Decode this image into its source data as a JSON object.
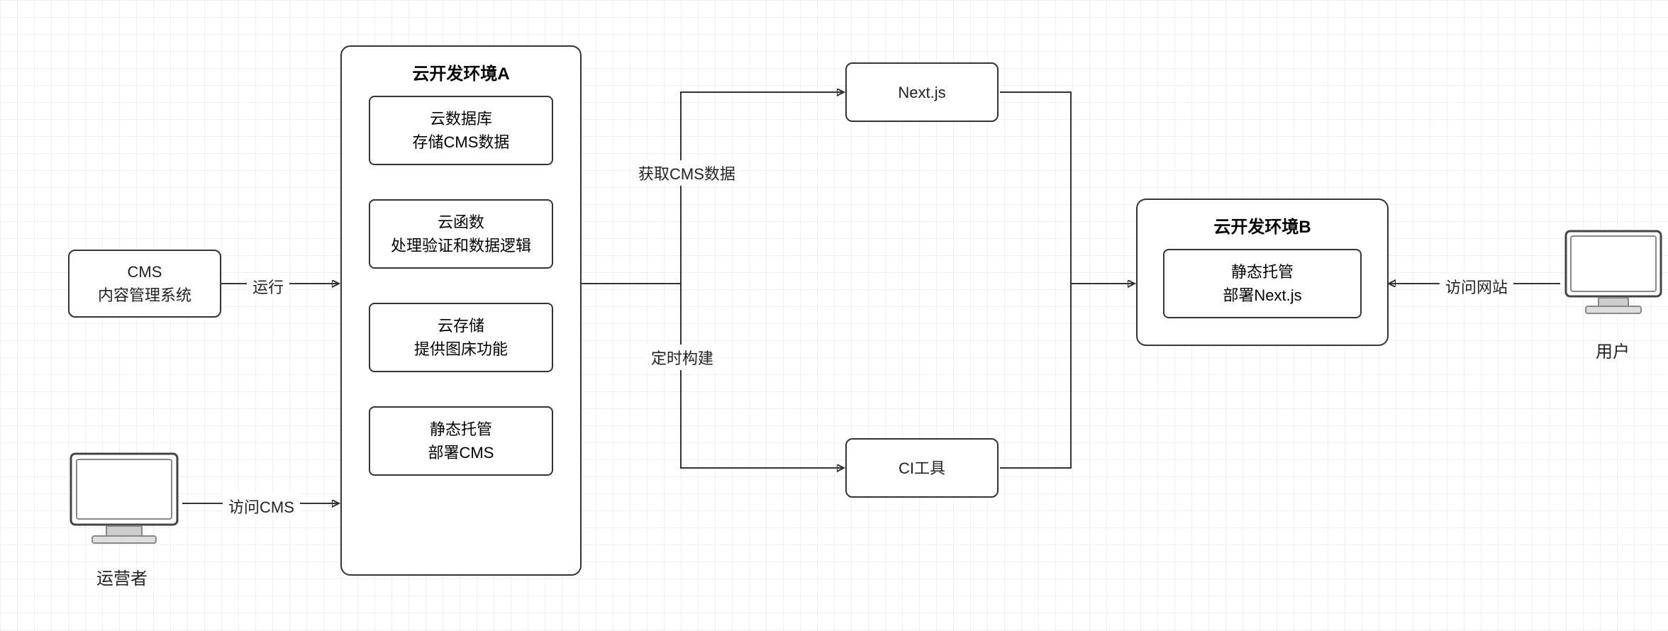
{
  "nodes": {
    "cms": {
      "line1": "CMS",
      "line2": "内容管理系统"
    },
    "envA": {
      "title": "云开发环境A",
      "db": {
        "line1": "云数据库",
        "line2": "存储CMS数据"
      },
      "fn": {
        "line1": "云函数",
        "line2": "处理验证和数据逻辑"
      },
      "stor": {
        "line1": "云存储",
        "line2": "提供图床功能"
      },
      "host": {
        "line1": "静态托管",
        "line2": "部署CMS"
      }
    },
    "nextjs": {
      "line1": "Next.js"
    },
    "ci": {
      "line1": "CI工具"
    },
    "envB": {
      "title": "云开发环境B",
      "host": {
        "line1": "静态托管",
        "line2": "部署Next.js"
      }
    }
  },
  "edges": {
    "run": "运行",
    "visitCMS": "访问CMS",
    "getCMSData": "获取CMS数据",
    "cronBuild": "定时构建",
    "visitSite": "访问网站"
  },
  "actors": {
    "operator": "运营者",
    "user": "用户"
  }
}
